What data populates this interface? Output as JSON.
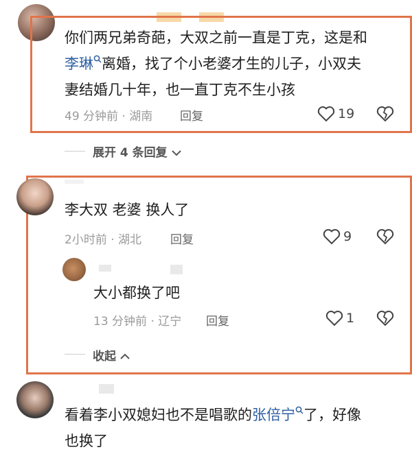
{
  "comments": [
    {
      "text_a": "你们两兄弟奇葩，大双之前一直是丁克，这是和",
      "link": "李琳",
      "text_b": "离婚，找了个小老婆才生的儿子，小双夫",
      "text_c": "妻结婚几十年，也一直丁克不生小孩",
      "meta": "49 分钟前 · 湖南",
      "reply": "回复",
      "likes": "19",
      "expand": "展开 4 条回复"
    },
    {
      "text": "李大双  老婆  换人了",
      "meta": "2小时前 · 湖北",
      "reply": "回复",
      "likes": "9",
      "sub_reply": {
        "text": "大小都换了吧",
        "meta": "13 分钟前 · 辽宁",
        "reply": "回复",
        "likes": "1"
      },
      "collapse": "收起"
    },
    {
      "text_a": "看着李小双媳妇也不是唱歌的",
      "link": "张倍宁",
      "text_b": "了，好像",
      "text_c": "也换了"
    }
  ],
  "colors": {
    "highlight_border": "#e0744a",
    "link": "#2e5fa3"
  },
  "icons": [
    "heart-icon",
    "broken-heart-icon",
    "search-icon",
    "chevron-down-icon",
    "chevron-up-icon"
  ]
}
